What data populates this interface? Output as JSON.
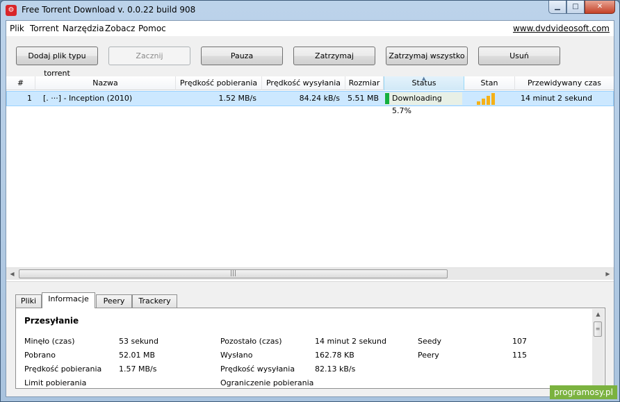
{
  "window": {
    "title": "Free Torrent Download v. 0.0.22 build 908",
    "controls": {
      "minimize": "▁",
      "maximize": "□",
      "close": "✕"
    }
  },
  "menu": {
    "items": [
      "Plik",
      "Torrent",
      "Narzędzia",
      "Zobacz",
      "Pomoc"
    ],
    "site_link": "www.dvdvideosoft.com"
  },
  "toolbar": {
    "add_torrent": "Dodaj plik typu torrent",
    "start": "Zacznij",
    "pause": "Pauza",
    "stop": "Zatrzymaj",
    "stop_all": "Zatrzymaj wszystko",
    "remove": "Usuń"
  },
  "table": {
    "columns": [
      "#",
      "Nazwa",
      "Prędkość pobierania",
      "Prędkość wysyłania",
      "Rozmiar",
      "Status",
      "Stan",
      "Przewidywany czas"
    ],
    "sorted_column": "Status",
    "rows": [
      {
        "num": "1",
        "name": "[.            ···]  - Inception (2010)",
        "download_speed": "1.52 MB/s",
        "upload_speed": "84.24 kB/s",
        "size": "5.51 MB",
        "status": "Downloading 5.7%",
        "status_progress": 0.057,
        "health_bars": 4,
        "eta": "14 minut 2 sekund"
      }
    ]
  },
  "tabs": {
    "items": [
      "Pliki",
      "Informacje",
      "Peery",
      "Trackery"
    ],
    "active": "Informacje"
  },
  "info": {
    "section_title": "Przesyłanie",
    "col1": [
      {
        "label": "Minęło (czas)",
        "value": "53 sekund"
      },
      {
        "label": "Pobrano",
        "value": "52.01 MB"
      },
      {
        "label": "Prędkość pobierania",
        "value": "1.57 MB/s"
      },
      {
        "label": "Limit pobierania",
        "value": ""
      }
    ],
    "col2": [
      {
        "label": "Pozostało (czas)",
        "value": "14 minut 2 sekund"
      },
      {
        "label": "Wysłano",
        "value": "162.78 KB"
      },
      {
        "label": "Prędkość wysyłania",
        "value": "82.13 kB/s"
      },
      {
        "label": "Ograniczenie pobierania",
        "value": ""
      }
    ],
    "col3": [
      {
        "label": "Seedy",
        "value": "107"
      },
      {
        "label": "Peery",
        "value": "115"
      }
    ]
  },
  "watermark": "programosy.pl",
  "colors": {
    "status_fill": "#16b040",
    "health_bar": "#f5b117",
    "selection": "#cce8ff"
  }
}
